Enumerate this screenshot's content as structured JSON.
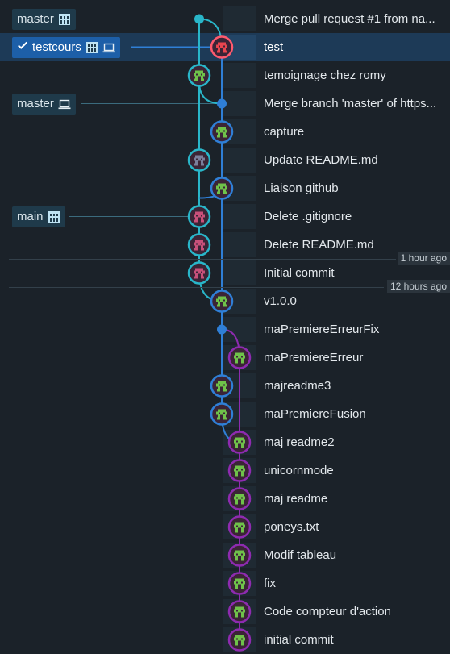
{
  "branches": [
    {
      "label": "master",
      "row": 0,
      "active": false,
      "checked": false,
      "icons": [
        "server-icon"
      ]
    },
    {
      "label": "testcours",
      "row": 1,
      "active": true,
      "checked": true,
      "icons": [
        "server-icon",
        "laptop-icon"
      ]
    },
    {
      "label": "master",
      "row": 3,
      "active": false,
      "checked": false,
      "icons": [
        "laptop-icon"
      ]
    },
    {
      "label": "main",
      "row": 7,
      "active": false,
      "checked": false,
      "icons": [
        "server-icon"
      ]
    }
  ],
  "commits": [
    {
      "message": "Merge pull request #1 from na...",
      "lane": 0,
      "node": "dot",
      "color": "#29b6c9"
    },
    {
      "message": "test",
      "lane": 1,
      "node": "avatar-red",
      "color": "#2f7fd6"
    },
    {
      "message": "temoignage chez romy",
      "lane": 0,
      "node": "avatar-green",
      "color": "#29b6c9"
    },
    {
      "message": "Merge branch 'master' of https...",
      "lane": 1,
      "node": "dot",
      "color": "#2f7fd6"
    },
    {
      "message": "capture",
      "lane": 1,
      "node": "avatar-green",
      "color": "#2f7fd6"
    },
    {
      "message": "Update README.md",
      "lane": 0,
      "node": "avatar-gray",
      "color": "#29b6c9"
    },
    {
      "message": "Liaison github",
      "lane": 1,
      "node": "avatar-green",
      "color": "#2f7fd6"
    },
    {
      "message": "Delete .gitignore",
      "lane": 0,
      "node": "avatar-pink",
      "color": "#29b6c9"
    },
    {
      "message": "Delete README.md",
      "lane": 0,
      "node": "avatar-pink",
      "color": "#29b6c9"
    },
    {
      "message": "Initial commit",
      "lane": 0,
      "node": "avatar-pink",
      "color": "#29b6c9"
    },
    {
      "message": "v1.0.0",
      "lane": 1,
      "node": "avatar-green",
      "color": "#2f7fd6"
    },
    {
      "message": "maPremiereErreurFix",
      "lane": 1,
      "node": "dot",
      "color": "#2f7fd6"
    },
    {
      "message": "maPremiereErreur",
      "lane": 2,
      "node": "avatar-green",
      "color": "#8e2bb0"
    },
    {
      "message": "majreadme3",
      "lane": 1,
      "node": "avatar-green",
      "color": "#2f7fd6"
    },
    {
      "message": "maPremiereFusion",
      "lane": 1,
      "node": "avatar-green",
      "color": "#2f7fd6"
    },
    {
      "message": "maj readme2",
      "lane": 2,
      "node": "avatar-green",
      "color": "#8e2bb0"
    },
    {
      "message": "unicornmode",
      "lane": 2,
      "node": "avatar-green",
      "color": "#8e2bb0"
    },
    {
      "message": "maj readme",
      "lane": 2,
      "node": "avatar-green",
      "color": "#8e2bb0"
    },
    {
      "message": "poneys.txt",
      "lane": 2,
      "node": "avatar-green",
      "color": "#8e2bb0"
    },
    {
      "message": "Modif tableau",
      "lane": 2,
      "node": "avatar-green",
      "color": "#8e2bb0"
    },
    {
      "message": "fix",
      "lane": 2,
      "node": "avatar-green",
      "color": "#8e2bb0"
    },
    {
      "message": "Code compteur d'action",
      "lane": 2,
      "node": "avatar-green",
      "color": "#8e2bb0"
    },
    {
      "message": "initial commit",
      "lane": 2,
      "node": "avatar-green",
      "color": "#8e2bb0"
    }
  ],
  "time_markers": [
    {
      "label": "1 hour ago",
      "after_row": 8
    },
    {
      "label": "12 hours ago",
      "after_row": 9
    }
  ],
  "selected_row": 1,
  "colors": {
    "lane_teal": "#29b6c9",
    "lane_blue": "#2f7fd6",
    "lane_purple": "#8e2bb0",
    "selection": "#1d5fa8",
    "background": "#1b2229"
  }
}
